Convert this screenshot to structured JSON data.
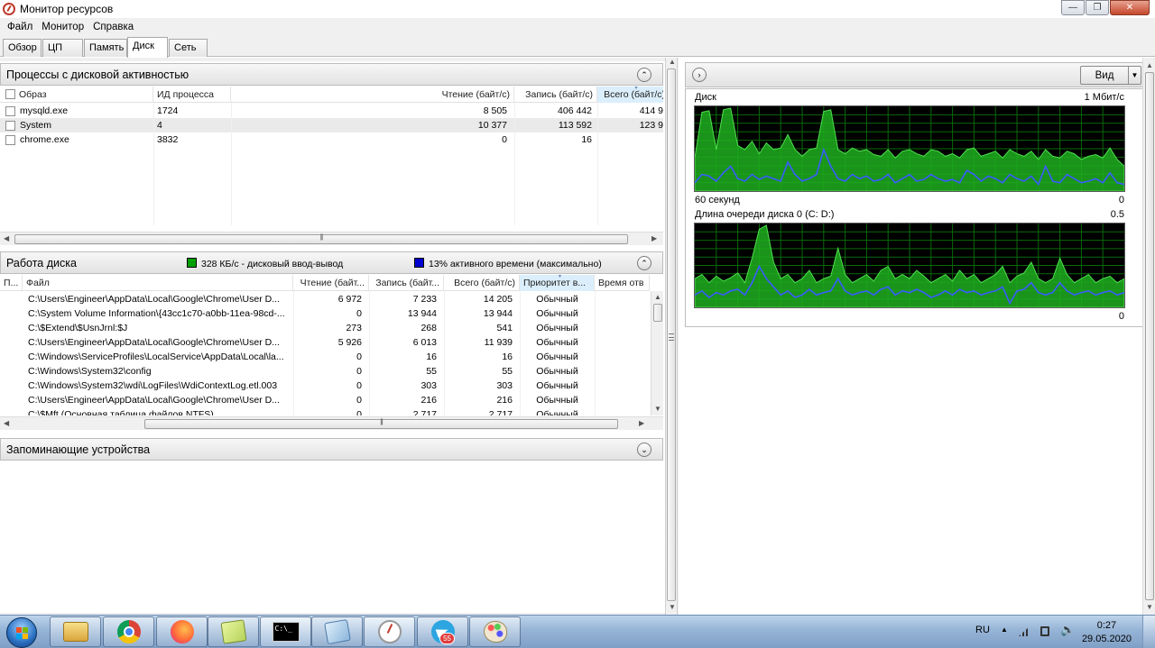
{
  "window": {
    "title": "Монитор ресурсов",
    "min": "—",
    "max": "❐",
    "close": "✕"
  },
  "menu": [
    "Файл",
    "Монитор",
    "Справка"
  ],
  "tabs": [
    "Обзор",
    "ЦП",
    "Память",
    "Диск",
    "Сеть"
  ],
  "active_tab": "Диск",
  "processes": {
    "title": "Процессы с дисковой активностью",
    "columns": [
      "Образ",
      "ИД процесса",
      "Чтение (байт/с)",
      "Запись (байт/с)",
      "Всего (байт/с)"
    ],
    "rows": [
      {
        "image": "mysqld.exe",
        "pid": "1724",
        "read": "8 505",
        "write": "406 442",
        "total": "414 9"
      },
      {
        "image": "System",
        "pid": "4",
        "read": "10 377",
        "write": "113 592",
        "total": "123 9"
      },
      {
        "image": "chrome.exe",
        "pid": "3832",
        "read": "0",
        "write": "16",
        "total": ""
      }
    ]
  },
  "disk_activity": {
    "title": "Работа диска",
    "io_legend": "328 КБ/с - дисковый ввод-вывод",
    "active_legend": "13% активного времени (максимально)",
    "io_color": "#00a000",
    "active_color": "#0000d0",
    "columns": [
      "П...",
      "Файл",
      "Чтение (байт...",
      "Запись (байт...",
      "Всего (байт/с)",
      "Приоритет в...",
      "Время отв"
    ],
    "rows": [
      {
        "file": "C:\\Users\\Engineer\\AppData\\Local\\Google\\Chrome\\User D...",
        "read": "6 972",
        "write": "7 233",
        "total": "14 205",
        "priority": "Обычный"
      },
      {
        "file": "C:\\System Volume Information\\{43cc1c70-a0bb-11ea-98cd-...",
        "read": "0",
        "write": "13 944",
        "total": "13 944",
        "priority": "Обычный"
      },
      {
        "file": "C:\\$Extend\\$UsnJrnl:$J",
        "read": "273",
        "write": "268",
        "total": "541",
        "priority": "Обычный"
      },
      {
        "file": "C:\\Users\\Engineer\\AppData\\Local\\Google\\Chrome\\User D...",
        "read": "5 926",
        "write": "6 013",
        "total": "11 939",
        "priority": "Обычный"
      },
      {
        "file": "C:\\Windows\\ServiceProfiles\\LocalService\\AppData\\Local\\la...",
        "read": "0",
        "write": "16",
        "total": "16",
        "priority": "Обычный"
      },
      {
        "file": "C:\\Windows\\System32\\config",
        "read": "0",
        "write": "55",
        "total": "55",
        "priority": "Обычный"
      },
      {
        "file": "C:\\Windows\\System32\\wdi\\LogFiles\\WdiContextLog.etl.003",
        "read": "0",
        "write": "303",
        "total": "303",
        "priority": "Обычный"
      },
      {
        "file": "C:\\Users\\Engineer\\AppData\\Local\\Google\\Chrome\\User D...",
        "read": "0",
        "write": "216",
        "total": "216",
        "priority": "Обычный"
      },
      {
        "file": "C:\\$Mft (Основная таблица файлов NTFS)",
        "read": "0",
        "write": "2 717",
        "total": "2 717",
        "priority": "Обычный"
      }
    ]
  },
  "storage": {
    "title": "Запоминающие устройства"
  },
  "right_pane": {
    "view_button": "Вид",
    "disk_graph": {
      "label": "Диск",
      "max_label": "1 Мбит/с",
      "time_label": "60 секунд",
      "min_label": "0",
      "green_series": [
        0.4,
        0.95,
        0.97,
        0.5,
        0.98,
        1.0,
        0.55,
        0.5,
        0.6,
        0.45,
        0.58,
        0.5,
        0.52,
        0.68,
        0.5,
        0.42,
        0.5,
        0.52,
        0.96,
        0.98,
        0.5,
        0.45,
        0.52,
        0.48,
        0.5,
        0.44,
        0.42,
        0.5,
        0.4,
        0.48,
        0.5,
        0.45,
        0.42,
        0.5,
        0.48,
        0.42,
        0.45,
        0.4,
        0.5,
        0.52,
        0.42,
        0.45,
        0.48,
        0.4,
        0.5,
        0.45,
        0.42,
        0.48,
        0.38,
        0.5,
        0.42,
        0.4,
        0.48,
        0.45,
        0.38,
        0.42,
        0.44,
        0.4,
        0.52,
        0.38,
        0.3
      ],
      "blue_series": [
        0.1,
        0.2,
        0.18,
        0.12,
        0.22,
        0.3,
        0.15,
        0.12,
        0.2,
        0.14,
        0.18,
        0.15,
        0.12,
        0.35,
        0.2,
        0.12,
        0.15,
        0.2,
        0.5,
        0.3,
        0.15,
        0.12,
        0.2,
        0.15,
        0.18,
        0.12,
        0.14,
        0.2,
        0.1,
        0.15,
        0.2,
        0.12,
        0.14,
        0.2,
        0.15,
        0.12,
        0.14,
        0.1,
        0.25,
        0.2,
        0.12,
        0.18,
        0.15,
        0.1,
        0.2,
        0.15,
        0.12,
        0.18,
        0.08,
        0.3,
        0.12,
        0.1,
        0.2,
        0.15,
        0.1,
        0.12,
        0.15,
        0.1,
        0.22,
        0.1,
        0.08
      ]
    },
    "queue_graph": {
      "label": "Длина очереди диска 0 (C: D:)",
      "max_label": "0.5",
      "min_label": "0",
      "green_series": [
        0.35,
        0.4,
        0.3,
        0.38,
        0.32,
        0.36,
        0.42,
        0.3,
        0.6,
        0.95,
        1.0,
        0.55,
        0.35,
        0.4,
        0.3,
        0.35,
        0.45,
        0.3,
        0.35,
        0.38,
        0.72,
        0.4,
        0.3,
        0.35,
        0.4,
        0.32,
        0.45,
        0.5,
        0.35,
        0.4,
        0.35,
        0.45,
        0.38,
        0.3,
        0.35,
        0.4,
        0.32,
        0.45,
        0.35,
        0.4,
        0.3,
        0.35,
        0.4,
        0.5,
        0.3,
        0.38,
        0.42,
        0.55,
        0.35,
        0.3,
        0.35,
        0.6,
        0.4,
        0.3,
        0.35,
        0.4,
        0.3,
        0.35,
        0.38,
        0.3,
        0.35
      ],
      "blue_series": [
        0.15,
        0.2,
        0.12,
        0.18,
        0.15,
        0.2,
        0.22,
        0.15,
        0.3,
        0.5,
        0.35,
        0.25,
        0.15,
        0.2,
        0.12,
        0.15,
        0.22,
        0.15,
        0.18,
        0.2,
        0.35,
        0.2,
        0.15,
        0.18,
        0.2,
        0.15,
        0.22,
        0.25,
        0.15,
        0.2,
        0.18,
        0.22,
        0.18,
        0.12,
        0.15,
        0.2,
        0.15,
        0.22,
        0.18,
        0.2,
        0.15,
        0.18,
        0.2,
        0.25,
        0.05,
        0.2,
        0.22,
        0.3,
        0.18,
        0.15,
        0.18,
        0.3,
        0.2,
        0.15,
        0.18,
        0.2,
        0.15,
        0.18,
        0.2,
        0.15,
        0.18
      ]
    }
  },
  "taskbar": {
    "apps": [
      "folder-icon",
      "chrome-icon",
      "firefox-icon",
      "sticky-notes-icon",
      "cmd-icon",
      "notepad-icon",
      "resource-monitor-icon",
      "telegram-icon",
      "paint-icon"
    ],
    "cmd_text": "C:\\_",
    "telegram_badge": "55",
    "lang": "RU",
    "time": "0:27",
    "date": "29.05.2020"
  }
}
